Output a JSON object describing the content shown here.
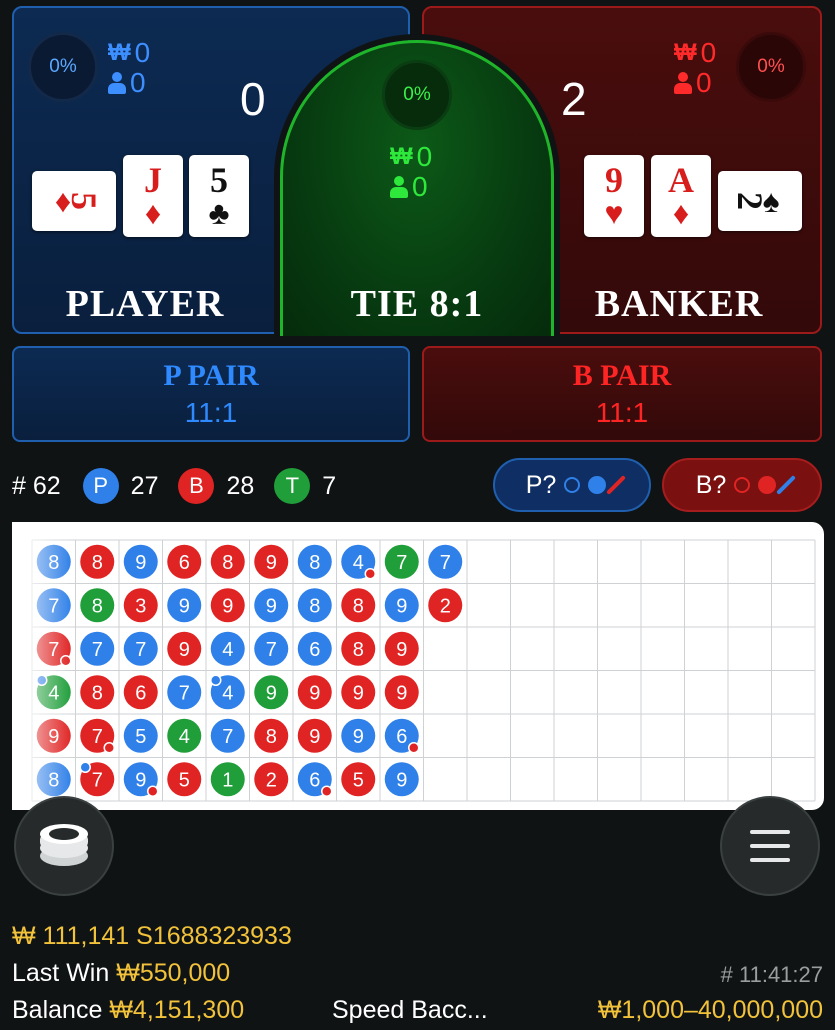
{
  "player": {
    "percent": "0%",
    "amount_symbol": "₩",
    "amount": "0",
    "bettors": "0",
    "score": "0",
    "label": "PLAYER",
    "cards": [
      {
        "rank": "5",
        "suit": "♦",
        "color": "red",
        "orientation": "side"
      },
      {
        "rank": "J",
        "suit": "♦",
        "color": "red",
        "orientation": "upright"
      },
      {
        "rank": "5",
        "suit": "♣",
        "color": "black",
        "orientation": "upright"
      }
    ]
  },
  "tie": {
    "percent": "0%",
    "amount_symbol": "₩",
    "amount": "0",
    "bettors": "0",
    "label": "TIE 8:1"
  },
  "banker": {
    "percent": "0%",
    "amount_symbol": "₩",
    "amount": "0",
    "bettors": "0",
    "score": "2",
    "label": "BANKER",
    "cards": [
      {
        "rank": "9",
        "suit": "♥",
        "color": "red",
        "orientation": "upright"
      },
      {
        "rank": "A",
        "suit": "♦",
        "color": "red",
        "orientation": "upright"
      },
      {
        "rank": "2",
        "suit": "♠",
        "color": "black",
        "orientation": "side"
      }
    ]
  },
  "pairs": {
    "player": {
      "label": "P PAIR",
      "odds": "11:1"
    },
    "banker": {
      "label": "B PAIR",
      "odds": "11:1"
    }
  },
  "stats": {
    "round": "# 62",
    "player_chip": "P",
    "player_count": "27",
    "banker_chip": "B",
    "banker_count": "28",
    "tie_chip": "T",
    "tie_count": "7"
  },
  "predict": {
    "player_label": "P?",
    "banker_label": "B?"
  },
  "colors": {
    "player": "#2f80e8",
    "banker": "#e02424",
    "tie": "#1f9e3a",
    "gold": "#f2c23a"
  },
  "road": {
    "columns": [
      [
        {
          "n": "8",
          "c": "P"
        },
        {
          "n": "7",
          "c": "P"
        },
        {
          "n": "7",
          "c": "B",
          "bp": true
        },
        {
          "n": "4",
          "c": "T",
          "pp": true
        },
        {
          "n": "9",
          "c": "B"
        },
        {
          "n": "8",
          "c": "P"
        }
      ],
      [
        {
          "n": "8",
          "c": "B"
        },
        {
          "n": "8",
          "c": "T"
        },
        {
          "n": "7",
          "c": "P"
        },
        {
          "n": "8",
          "c": "B"
        },
        {
          "n": "7",
          "c": "B",
          "bp": true
        },
        {
          "n": "7",
          "c": "B",
          "pp": true
        }
      ],
      [
        {
          "n": "9",
          "c": "P"
        },
        {
          "n": "3",
          "c": "B"
        },
        {
          "n": "7",
          "c": "P"
        },
        {
          "n": "6",
          "c": "B"
        },
        {
          "n": "5",
          "c": "P"
        },
        {
          "n": "9",
          "c": "P",
          "bp": true
        }
      ],
      [
        {
          "n": "6",
          "c": "B"
        },
        {
          "n": "9",
          "c": "P"
        },
        {
          "n": "9",
          "c": "B"
        },
        {
          "n": "7",
          "c": "P"
        },
        {
          "n": "4",
          "c": "T"
        },
        {
          "n": "5",
          "c": "B"
        }
      ],
      [
        {
          "n": "8",
          "c": "B"
        },
        {
          "n": "9",
          "c": "B"
        },
        {
          "n": "4",
          "c": "P"
        },
        {
          "n": "4",
          "c": "P",
          "pp": true
        },
        {
          "n": "7",
          "c": "P"
        },
        {
          "n": "1",
          "c": "T"
        }
      ],
      [
        {
          "n": "9",
          "c": "B"
        },
        {
          "n": "9",
          "c": "P"
        },
        {
          "n": "7",
          "c": "P"
        },
        {
          "n": "9",
          "c": "T"
        },
        {
          "n": "8",
          "c": "B"
        },
        {
          "n": "2",
          "c": "B"
        }
      ],
      [
        {
          "n": "8",
          "c": "P"
        },
        {
          "n": "8",
          "c": "P"
        },
        {
          "n": "6",
          "c": "P"
        },
        {
          "n": "9",
          "c": "B"
        },
        {
          "n": "9",
          "c": "B"
        },
        {
          "n": "6",
          "c": "P",
          "bp": true
        }
      ],
      [
        {
          "n": "4",
          "c": "P",
          "bp": true
        },
        {
          "n": "8",
          "c": "B"
        },
        {
          "n": "8",
          "c": "B"
        },
        {
          "n": "9",
          "c": "B"
        },
        {
          "n": "9",
          "c": "P"
        },
        {
          "n": "5",
          "c": "B"
        }
      ],
      [
        {
          "n": "7",
          "c": "T"
        },
        {
          "n": "9",
          "c": "P"
        },
        {
          "n": "9",
          "c": "B"
        },
        {
          "n": "9",
          "c": "B"
        },
        {
          "n": "6",
          "c": "P",
          "bp": true
        },
        {
          "n": "9",
          "c": "P"
        }
      ],
      [
        {
          "n": "7",
          "c": "P"
        },
        {
          "n": "2",
          "c": "B"
        }
      ]
    ]
  },
  "footer": {
    "balance_short": "₩ 111,141",
    "session_id": "S1688323933",
    "last_win_label": "Last Win",
    "last_win_value": "₩550,000",
    "round_time": "# 11:41:27",
    "balance_label": "Balance",
    "balance_value": "₩4,151,300",
    "table_name": "Speed Bacc...",
    "limits": "₩1,000–40,000,000"
  }
}
